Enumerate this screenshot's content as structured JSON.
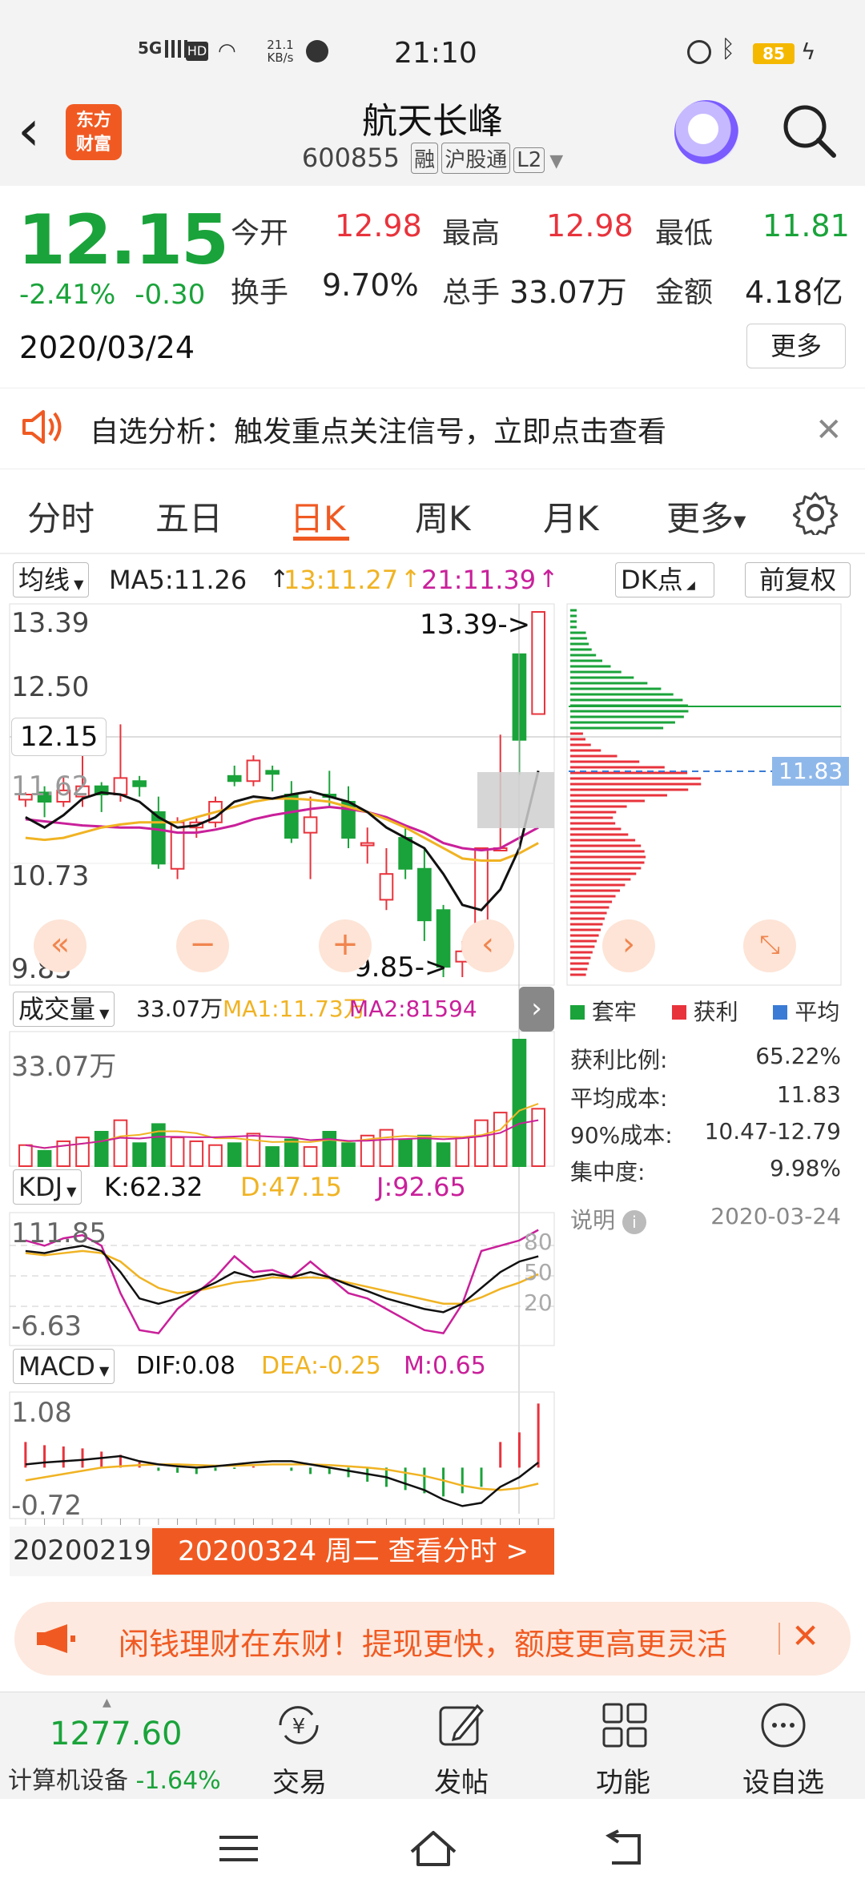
{
  "status_bar": {
    "network": "5G",
    "hd": "HD",
    "speed": "21.1 KB/s",
    "time": "21:10",
    "battery": "85"
  },
  "header": {
    "logo_line1": "东方",
    "logo_line2": "财富",
    "stock_name": "航天长峰",
    "stock_code": "600855",
    "tags": [
      "融",
      "沪股通",
      "L2"
    ]
  },
  "quote": {
    "price": "12.15",
    "change_pct": "-2.41%",
    "change": "-0.30",
    "date": "2020/03/24",
    "open_label": "今开",
    "open": "12.98",
    "high_label": "最高",
    "high": "12.98",
    "low_label": "最低",
    "low": "11.81",
    "turnover_label": "换手",
    "turnover": "9.70%",
    "volume_label": "总手",
    "volume": "33.07万",
    "amount_label": "金额",
    "amount": "4.18亿",
    "more": "更多"
  },
  "notice": {
    "text": "自选分析：触发重点关注信号，立即点击查看"
  },
  "tabs": [
    "分时",
    "五日",
    "日K",
    "周K",
    "月K",
    "更多"
  ],
  "active_tab": "日K",
  "chart": {
    "indicator_select": "均线",
    "ma5": "MA5:11.26",
    "ma13": "13:11.27",
    "ma21": "21:11.39",
    "dk_select": "DK点",
    "fq_button": "前复权",
    "y_labels": [
      "13.39",
      "12.50",
      "12.15",
      "11.62",
      "10.73",
      "9.85"
    ],
    "high_marker": "13.39->",
    "low_marker": "9.85->",
    "cost_label": "11.83",
    "volume_select": "成交量",
    "vol_value": "33.07万",
    "vol_ma1": "MA1:11.73万",
    "vol_ma2": "MA2:81594",
    "vol_axis": "33.07万",
    "kdj_select": "KDJ",
    "kdj_k": "K:62.32",
    "kdj_d": "D:47.15",
    "kdj_j": "J:92.65",
    "kdj_top": "111.85",
    "kdj_bottom": "-6.63",
    "kdj_levels": [
      "80",
      "50",
      "20"
    ],
    "macd_select": "MACD",
    "macd_dif": "DIF:0.08",
    "macd_dea": "DEA:-0.25",
    "macd_m": "M:0.65",
    "macd_top": "1.08",
    "macd_bottom": "-0.72",
    "start_date": "20200219",
    "view_bar": "20200324 周二 查看分时 >"
  },
  "chip": {
    "legend": [
      "套牢",
      "获利",
      "平均"
    ],
    "stats": [
      {
        "k": "获利比例:",
        "v": "65.22%"
      },
      {
        "k": "平均成本:",
        "v": "11.83"
      },
      {
        "k": "90%成本:",
        "v": "10.47-12.79"
      },
      {
        "k": "集中度:",
        "v": "9.98%"
      }
    ],
    "note_label": "说明",
    "note_date": "2020-03-24"
  },
  "banner": {
    "text": "闲钱理财在东财！提现更快，额度更高更灵活"
  },
  "bottom_nav": {
    "index_value": "1277.60",
    "index_name": "计算机设备",
    "index_change": "-1.64%",
    "items": [
      "交易",
      "发帖",
      "功能",
      "设自选"
    ]
  },
  "colors": {
    "up": "#e8333c",
    "down": "#1aa33a",
    "accent": "#f05a22",
    "ma5": "#111111",
    "ma13": "#f0b323",
    "ma21": "#c9209a"
  },
  "chart_data": {
    "type": "candlestick",
    "title": "",
    "ylim": [
      9.85,
      13.39
    ],
    "candles": [
      {
        "o": 11.57,
        "c": 11.62,
        "h": 11.64,
        "l": 11.5
      },
      {
        "o": 11.64,
        "c": 11.55,
        "h": 11.7,
        "l": 11.4
      },
      {
        "o": 11.55,
        "c": 11.66,
        "h": 11.8,
        "l": 11.5
      },
      {
        "o": 11.6,
        "c": 11.7,
        "h": 12.1,
        "l": 11.5
      },
      {
        "o": 11.7,
        "c": 11.62,
        "h": 11.74,
        "l": 11.45
      },
      {
        "o": 11.62,
        "c": 11.78,
        "h": 12.3,
        "l": 11.55
      },
      {
        "o": 11.75,
        "c": 11.7,
        "h": 11.8,
        "l": 11.6
      },
      {
        "o": 11.45,
        "c": 10.95,
        "h": 11.6,
        "l": 10.9
      },
      {
        "o": 10.9,
        "c": 11.35,
        "h": 11.4,
        "l": 10.8
      },
      {
        "o": 11.3,
        "c": 11.35,
        "h": 11.4,
        "l": 11.2
      },
      {
        "o": 11.35,
        "c": 11.55,
        "h": 11.6,
        "l": 11.3
      },
      {
        "o": 11.8,
        "c": 11.75,
        "h": 11.9,
        "l": 11.7
      },
      {
        "o": 11.75,
        "c": 11.95,
        "h": 12.0,
        "l": 11.7
      },
      {
        "o": 11.85,
        "c": 11.82,
        "h": 11.9,
        "l": 11.65
      },
      {
        "o": 11.62,
        "c": 11.2,
        "h": 11.75,
        "l": 11.15
      },
      {
        "o": 11.25,
        "c": 11.4,
        "h": 11.6,
        "l": 10.8
      },
      {
        "o": 11.62,
        "c": 11.6,
        "h": 11.85,
        "l": 11.5
      },
      {
        "o": 11.55,
        "c": 11.2,
        "h": 11.7,
        "l": 11.1
      },
      {
        "o": 11.15,
        "c": 11.15,
        "h": 11.3,
        "l": 10.95
      },
      {
        "o": 10.6,
        "c": 10.85,
        "h": 11.1,
        "l": 10.5
      },
      {
        "o": 11.2,
        "c": 10.9,
        "h": 11.3,
        "l": 10.8
      },
      {
        "o": 10.9,
        "c": 10.4,
        "h": 11.1,
        "l": 10.2
      },
      {
        "o": 10.5,
        "c": 9.95,
        "h": 10.55,
        "l": 9.85
      },
      {
        "o": 10.0,
        "c": 10.1,
        "h": 10.2,
        "l": 9.85
      },
      {
        "o": 10.1,
        "c": 11.1,
        "h": 11.1,
        "l": 10.05
      },
      {
        "o": 11.1,
        "c": 11.1,
        "h": 12.2,
        "l": 11.1
      },
      {
        "o": 12.98,
        "c": 12.15,
        "h": 12.98,
        "l": 11.81
      },
      {
        "o": 12.4,
        "c": 13.39,
        "h": 13.39,
        "l": 12.4
      }
    ],
    "ma5": [
      11.4,
      11.3,
      11.42,
      11.58,
      11.64,
      11.62,
      11.55,
      11.4,
      11.3,
      11.32,
      11.4,
      11.55,
      11.6,
      11.58,
      11.62,
      11.65,
      11.6,
      11.55,
      11.45,
      11.3,
      11.2,
      11.1,
      10.85,
      10.55,
      10.5,
      10.7,
      11.1,
      11.85
    ],
    "ma13": [
      11.2,
      11.18,
      11.2,
      11.25,
      11.3,
      11.33,
      11.35,
      11.35,
      11.35,
      11.4,
      11.45,
      11.5,
      11.55,
      11.58,
      11.58,
      11.57,
      11.55,
      11.5,
      11.45,
      11.38,
      11.3,
      11.2,
      11.1,
      11.0,
      10.98,
      10.98,
      11.05,
      11.15
    ],
    "ma21": [
      11.38,
      11.36,
      11.34,
      11.32,
      11.31,
      11.3,
      11.3,
      11.28,
      11.25,
      11.25,
      11.28,
      11.32,
      11.38,
      11.42,
      11.45,
      11.48,
      11.5,
      11.48,
      11.45,
      11.4,
      11.32,
      11.25,
      11.15,
      11.1,
      11.08,
      11.1,
      11.2,
      11.3
    ],
    "volume": [
      55000,
      40000,
      65000,
      75000,
      90000,
      120000,
      60000,
      110000,
      75000,
      65000,
      55000,
      60000,
      85000,
      50000,
      70000,
      50000,
      90000,
      60000,
      80000,
      95000,
      70000,
      80000,
      60000,
      75000,
      120000,
      140000,
      330700,
      150000
    ],
    "vol_ylim": [
      0,
      330700
    ],
    "kdj_k": [
      80,
      78,
      82,
      85,
      80,
      60,
      35,
      30,
      35,
      42,
      50,
      60,
      55,
      58,
      55,
      60,
      55,
      48,
      42,
      35,
      30,
      25,
      22,
      30,
      45,
      60,
      70,
      75
    ],
    "kdj_d": [
      78,
      76,
      78,
      80,
      78,
      70,
      55,
      45,
      40,
      42,
      46,
      50,
      52,
      55,
      54,
      55,
      54,
      50,
      46,
      42,
      38,
      34,
      30,
      30,
      36,
      44,
      50,
      58
    ],
    "kdj_j": [
      90,
      85,
      92,
      95,
      85,
      40,
      5,
      2,
      25,
      40,
      55,
      75,
      60,
      62,
      55,
      70,
      55,
      40,
      35,
      25,
      15,
      5,
      2,
      30,
      80,
      85,
      90,
      100
    ],
    "kdj_ylim": [
      -6.63,
      111.85
    ],
    "macd_bar": [
      0.4,
      0.35,
      0.33,
      0.3,
      0.25,
      0.2,
      0.1,
      -0.05,
      -0.08,
      -0.1,
      -0.05,
      -0.02,
      0.02,
      0.0,
      -0.05,
      -0.1,
      -0.1,
      -0.15,
      -0.22,
      -0.3,
      -0.35,
      -0.4,
      -0.45,
      -0.4,
      -0.3,
      0.4,
      0.55,
      1.0
    ],
    "macd_dif": [
      0.05,
      0.08,
      0.1,
      0.12,
      0.15,
      0.18,
      0.1,
      0.05,
      0.02,
      0.0,
      0.02,
      0.05,
      0.08,
      0.1,
      0.1,
      0.05,
      0.0,
      -0.05,
      -0.1,
      -0.15,
      -0.25,
      -0.35,
      -0.5,
      -0.6,
      -0.55,
      -0.3,
      -0.15,
      0.08
    ],
    "macd_dea": [
      -0.2,
      -0.15,
      -0.1,
      -0.05,
      0.0,
      0.02,
      0.04,
      0.05,
      0.05,
      0.04,
      0.03,
      0.03,
      0.04,
      0.05,
      0.05,
      0.05,
      0.04,
      0.02,
      0.0,
      -0.03,
      -0.08,
      -0.13,
      -0.2,
      -0.28,
      -0.33,
      -0.35,
      -0.32,
      -0.25
    ],
    "macd_ylim": [
      -0.72,
      1.08
    ]
  }
}
